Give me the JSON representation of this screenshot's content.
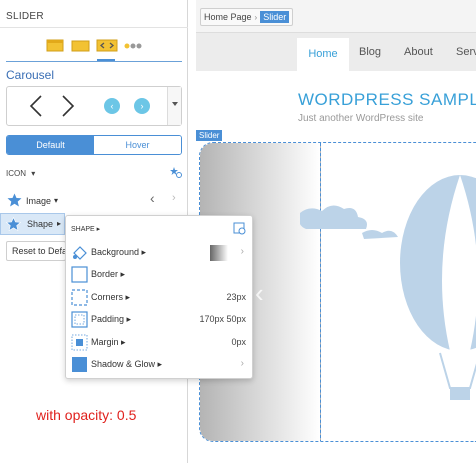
{
  "panel": {
    "title": "SLIDER",
    "toolbar": {
      "icons": [
        "background-tile-icon",
        "slides-tile-icon",
        "arrows-tile-icon",
        "dots-icon"
      ]
    },
    "section_label": "Carousel",
    "state_tabs": {
      "default": "Default",
      "hover": "Hover"
    },
    "icon_row": {
      "label": "ICON",
      "caret": "▾"
    },
    "image_row": {
      "label": "Image",
      "caret": "▾"
    },
    "shape_row": {
      "label": "Shape",
      "caret": "▸"
    },
    "reset_button": "Reset to Defa"
  },
  "note": "with opacity: 0.5",
  "site": {
    "breadcrumb": [
      "Home Page",
      "Slider"
    ],
    "nav": [
      "Home",
      "Blog",
      "About",
      "Serv"
    ],
    "title": "WORDPRESS SAMPLE",
    "tagline": "Just another WordPress site",
    "slider_tag": "Slider"
  },
  "popup": {
    "header": "SHAPE ▸",
    "rows": [
      {
        "label": "Background ▸",
        "value": "",
        "icon": "fill-bucket-icon"
      },
      {
        "label": "Border ▸",
        "value": "",
        "icon": "border-icon"
      },
      {
        "label": "Corners ▸",
        "value": "23px",
        "icon": "corners-icon"
      },
      {
        "label": "Padding ▸",
        "value": "170px 50px",
        "icon": "padding-icon"
      },
      {
        "label": "Margin ▸",
        "value": "0px",
        "icon": "margin-icon"
      },
      {
        "label": "Shadow & Glow ▸",
        "value": "",
        "icon": "shadow-glow-icon"
      }
    ]
  },
  "colors": {
    "accent": "#4a8fd6",
    "note": "#e0211d",
    "site_title": "#38a0d8"
  }
}
